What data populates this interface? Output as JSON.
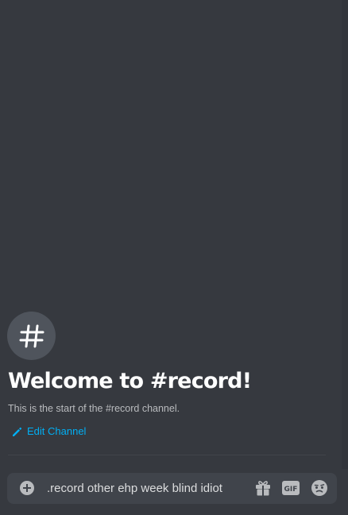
{
  "channel": {
    "icon": "hash-icon",
    "welcome_title": "Welcome to #record!",
    "welcome_subtitle": "This is the start of the #record channel.",
    "edit_label": "Edit Channel"
  },
  "composer": {
    "value": ".record other ehp week blind idiot",
    "icons": {
      "add": "plus-circle-icon",
      "gift": "gift-icon",
      "gif": "gif-icon",
      "emoji": "emoji-icon"
    },
    "gif_text": "GIF"
  },
  "colors": {
    "background": "#36393f",
    "input_background": "#40444b",
    "accent_link": "#00aff4",
    "heading": "#ffffff",
    "muted_text": "#b9bbbe",
    "icon_gray": "#b9bbbe"
  }
}
